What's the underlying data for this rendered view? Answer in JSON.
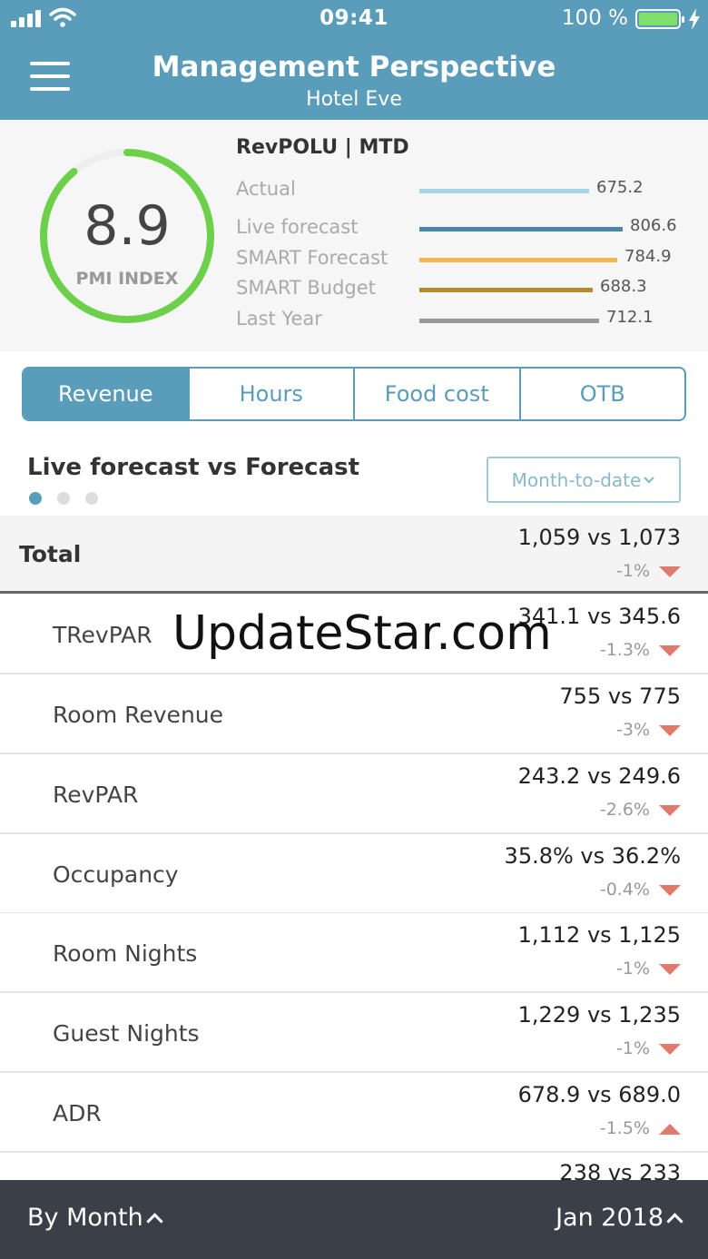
{
  "status_bar": {
    "time": "09:41",
    "battery": "100 %"
  },
  "header": {
    "title": "Management Perspective",
    "subtitle": "Hotel Eve"
  },
  "summary": {
    "pmi_value": "8.9",
    "pmi_label": "PMI INDEX",
    "pmi_ring_fraction": 0.89,
    "metric_title": "RevPOLU | MTD",
    "metrics": [
      {
        "label": "Actual",
        "value": "675.2",
        "color": "#a8d4e8"
      },
      {
        "label": "Live forecast",
        "value": "806.6",
        "color": "#4a86a8"
      },
      {
        "label": "SMART Forecast",
        "value": "784.9",
        "color": "#f0b84a"
      },
      {
        "label": "SMART Budget",
        "value": "688.3",
        "color": "#b8892c"
      },
      {
        "label": "Last Year",
        "value": "712.1",
        "color": "#999999"
      }
    ]
  },
  "tabs": [
    {
      "label": "Revenue",
      "active": true
    },
    {
      "label": "Hours",
      "active": false
    },
    {
      "label": "Food cost",
      "active": false
    },
    {
      "label": "OTB",
      "active": false
    }
  ],
  "section": {
    "title": "Live forecast vs Forecast",
    "period": "Month-to-date"
  },
  "total": {
    "label": "Total",
    "value": "1,059 vs 1,073",
    "delta": "-1%",
    "trend": "down"
  },
  "rows": [
    {
      "label": "TRevPAR",
      "value": "341.1 vs 345.6",
      "delta": "-1.3%",
      "trend": "down"
    },
    {
      "label": "Room Revenue",
      "value": "755 vs 775",
      "delta": "-3%",
      "trend": "down"
    },
    {
      "label": "RevPAR",
      "value": "243.2 vs 249.6",
      "delta": "-2.6%",
      "trend": "down"
    },
    {
      "label": "Occupancy",
      "value": "35.8% vs 36.2%",
      "delta": "-0.4%",
      "trend": "down"
    },
    {
      "label": "Room Nights",
      "value": "1,112 vs 1,125",
      "delta": "-1%",
      "trend": "down"
    },
    {
      "label": "Guest Nights",
      "value": "1,229 vs 1,235",
      "delta": "-1%",
      "trend": "down"
    },
    {
      "label": "ADR",
      "value": "678.9 vs 689.0",
      "delta": "-1.5%",
      "trend": "up"
    },
    {
      "label": "",
      "value": "238 vs 233",
      "delta": "",
      "trend": ""
    }
  ],
  "watermark": "UpdateStar.com",
  "bottom_bar": {
    "left": "By Month",
    "right": "Jan 2018"
  },
  "colors": {
    "accent": "#5a9dba",
    "gauge": "#6cd04a",
    "negative": "#e07a6c",
    "footer": "#3b3f48"
  }
}
